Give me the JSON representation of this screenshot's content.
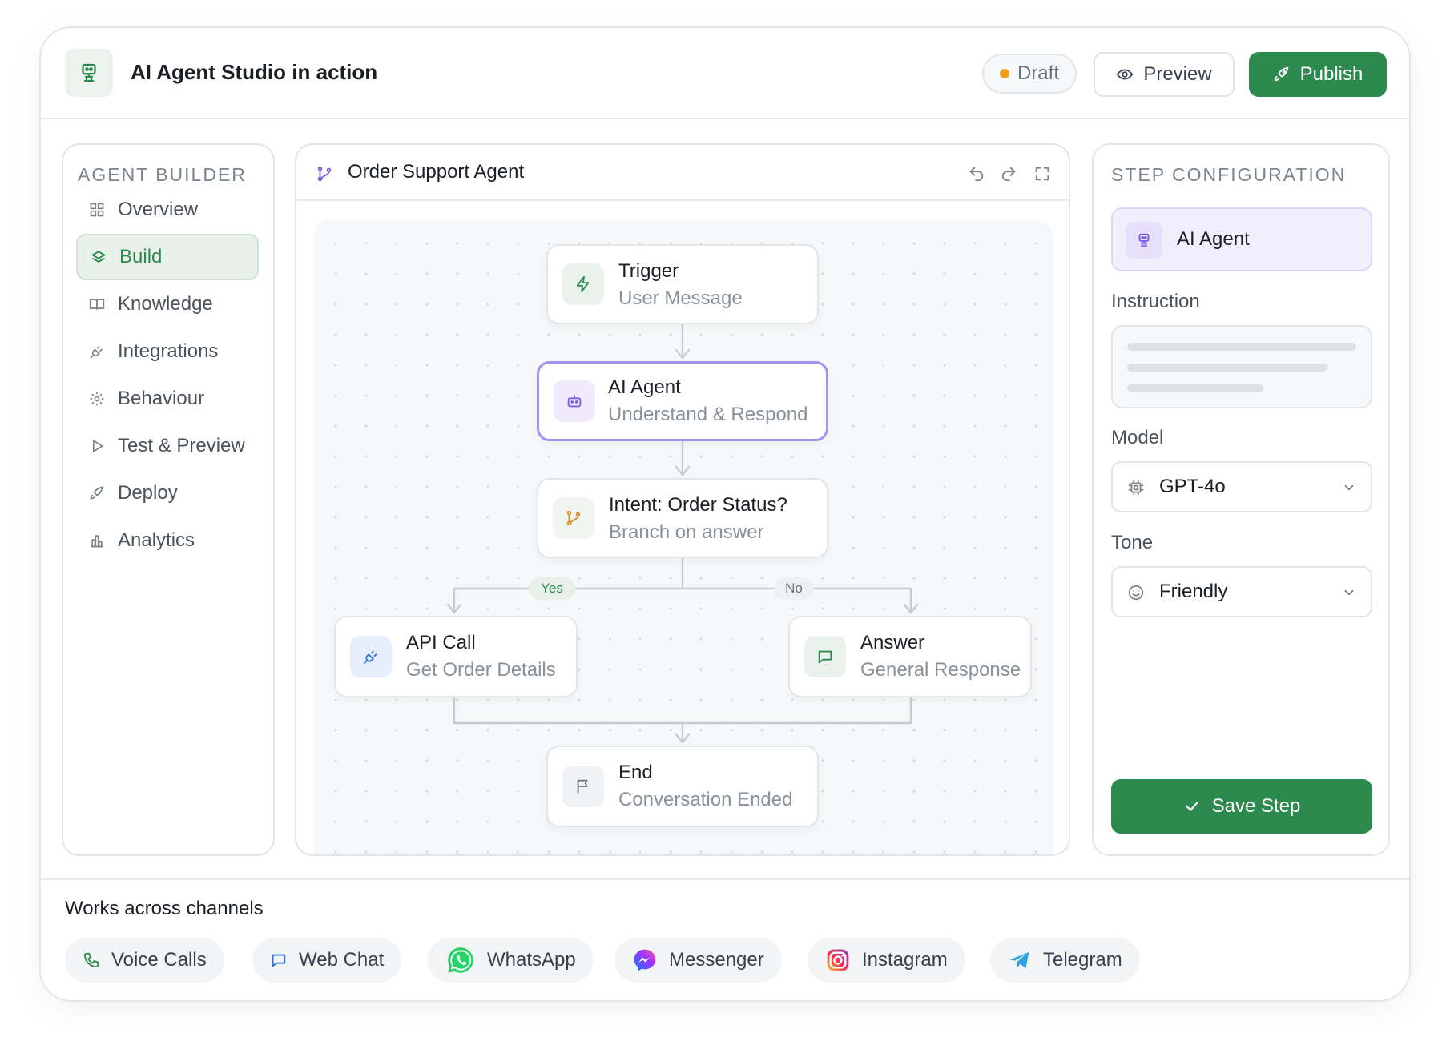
{
  "header": {
    "title": "AI Agent Studio in action",
    "draft_label": "Draft",
    "preview_label": "Preview",
    "publish_label": "Publish",
    "logo_icon": "robot-icon"
  },
  "sidebar": {
    "section_label": "AGENT BUILDER",
    "items": [
      {
        "label": "Overview",
        "icon": "grid-icon"
      },
      {
        "label": "Build",
        "icon": "layers-icon"
      },
      {
        "label": "Knowledge",
        "icon": "book-icon"
      },
      {
        "label": "Integrations",
        "icon": "plug-icon"
      },
      {
        "label": "Behaviour",
        "icon": "gear-icon"
      },
      {
        "label": "Test & Preview",
        "icon": "play-icon"
      },
      {
        "label": "Deploy",
        "icon": "rocket-icon"
      },
      {
        "label": "Analytics",
        "icon": "bar-chart-icon"
      }
    ],
    "active_item": "Build"
  },
  "canvas": {
    "title": "Order Support Agent",
    "nodes": [
      {
        "title": "Trigger",
        "subtitle": "User Message",
        "icon": "bolt-icon"
      },
      {
        "title": "AI Agent",
        "subtitle": "Understand & Respond",
        "icon": "robot-icon"
      },
      {
        "title": "Intent: Order Status?",
        "subtitle": "Branch on answer",
        "icon": "branch-icon"
      },
      {
        "title": "API Call",
        "subtitle": "Get Order Details",
        "icon": "plug-icon"
      },
      {
        "title": "Answer",
        "subtitle": "General Response",
        "icon": "chat-icon"
      },
      {
        "title": "End",
        "subtitle": "Conversation Ended",
        "icon": "flag-icon"
      }
    ],
    "branch_yes": "Yes",
    "branch_no": "No",
    "selected_node": "AI Agent"
  },
  "config": {
    "section_label": "STEP CONFIGURATION",
    "step_name": "AI Agent",
    "instruction_label": "Instruction",
    "model_label": "Model",
    "model_value": "GPT-4o",
    "tone_label": "Tone",
    "tone_value": "Friendly",
    "save_label": "Save Step"
  },
  "footer": {
    "title": "Works across channels",
    "channels": [
      "Voice Calls",
      "Web Chat",
      "WhatsApp",
      "Messenger",
      "Instagram",
      "Telegram"
    ]
  },
  "colors": {
    "brand_green": "#2d8a4e",
    "accent_purple": "#a592ee",
    "draft_dot": "#f0a020"
  }
}
